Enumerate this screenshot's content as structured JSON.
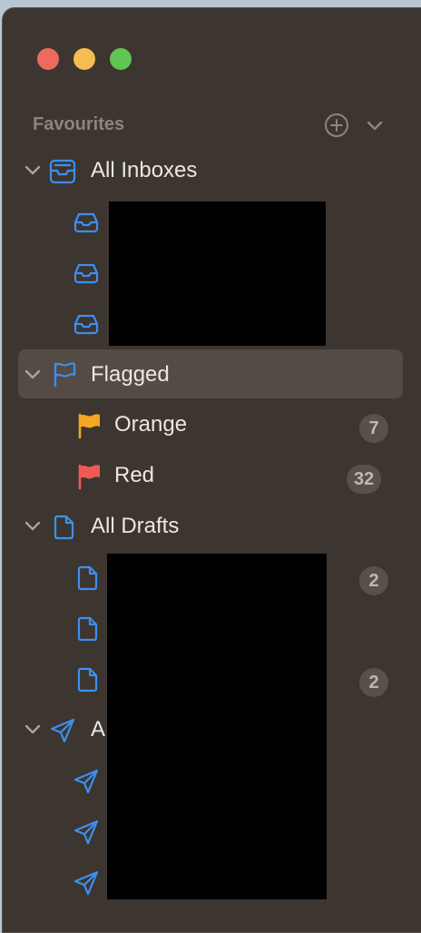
{
  "window": {
    "controls": [
      "close",
      "minimize",
      "zoom"
    ]
  },
  "sidebar": {
    "section_title": "Favourites",
    "accent_color": "#3d8ff0",
    "items": [
      {
        "label": "All Inboxes",
        "icon": "tray-icon",
        "expanded": true,
        "children": [
          {
            "icon": "tray-icon"
          },
          {
            "icon": "tray-icon"
          },
          {
            "icon": "tray-icon"
          }
        ]
      },
      {
        "label": "Flagged",
        "icon": "flag-outline-icon",
        "expanded": true,
        "selected": true,
        "children": [
          {
            "label": "Orange",
            "icon": "orange-flag-icon",
            "badge": "7",
            "color": "#f5a623"
          },
          {
            "label": "Red",
            "icon": "red-flag-icon",
            "badge": "32",
            "color": "#ef5b54"
          }
        ]
      },
      {
        "label": "All Drafts",
        "icon": "document-icon",
        "expanded": true,
        "children": [
          {
            "icon": "document-icon",
            "badge": "2"
          },
          {
            "icon": "document-icon"
          },
          {
            "icon": "document-icon",
            "badge": "2"
          }
        ]
      },
      {
        "label": "A",
        "icon": "paper-plane-icon",
        "expanded": true,
        "children": [
          {
            "icon": "paper-plane-icon"
          },
          {
            "icon": "paper-plane-icon"
          },
          {
            "icon": "paper-plane-icon"
          }
        ]
      }
    ]
  }
}
